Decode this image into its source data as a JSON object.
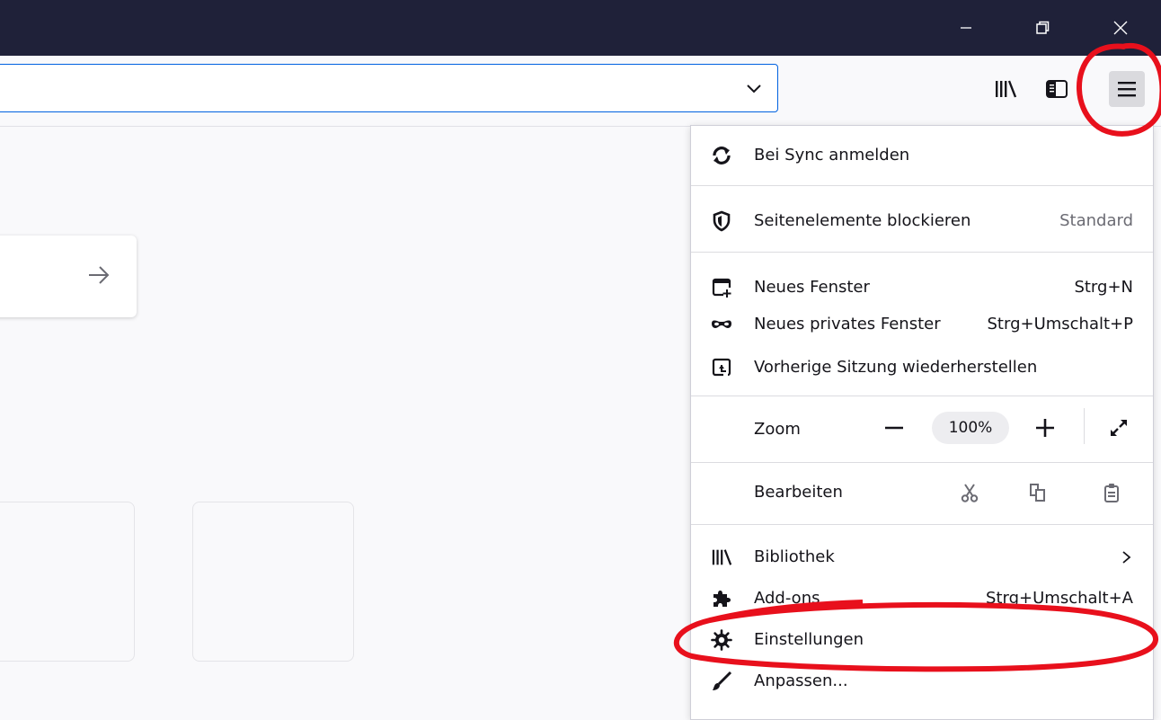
{
  "window_controls": {
    "minimize_icon": "minimize-icon",
    "restore_icon": "restore-icon",
    "close_icon": "close-icon"
  },
  "toolbar": {
    "library_icon": "library-icon",
    "sidebar_icon": "sidebar-icon",
    "menu_icon": "hamburger-menu-icon"
  },
  "menu": {
    "sync": {
      "label": "Bei Sync anmelden",
      "icon": "sync-icon"
    },
    "tracking": {
      "label": "Seitenelemente blockieren",
      "value": "Standard",
      "icon": "shield-icon"
    },
    "new_window": {
      "label": "Neues Fenster",
      "shortcut": "Strg+N",
      "icon": "new-window-icon"
    },
    "private_window": {
      "label": "Neues privates Fenster",
      "shortcut": "Strg+Umschalt+P",
      "icon": "mask-icon"
    },
    "restore_session": {
      "label": "Vorherige Sitzung wiederherstellen",
      "icon": "restore-session-icon"
    },
    "zoom": {
      "label": "Zoom",
      "value": "100%",
      "minus": "−",
      "plus": "+"
    },
    "edit": {
      "label": "Bearbeiten"
    },
    "library": {
      "label": "Bibliothek",
      "icon": "library-icon"
    },
    "addons": {
      "label": "Add-ons",
      "shortcut": "Strg+Umschalt+A",
      "icon": "puzzle-icon"
    },
    "settings": {
      "label": "Einstellungen",
      "icon": "gear-icon"
    },
    "customize": {
      "label": "Anpassen...",
      "icon": "brush-icon"
    }
  },
  "colors": {
    "titlebar": "#1f2139",
    "accent": "#0061e0",
    "annotation": "#e8101c"
  }
}
